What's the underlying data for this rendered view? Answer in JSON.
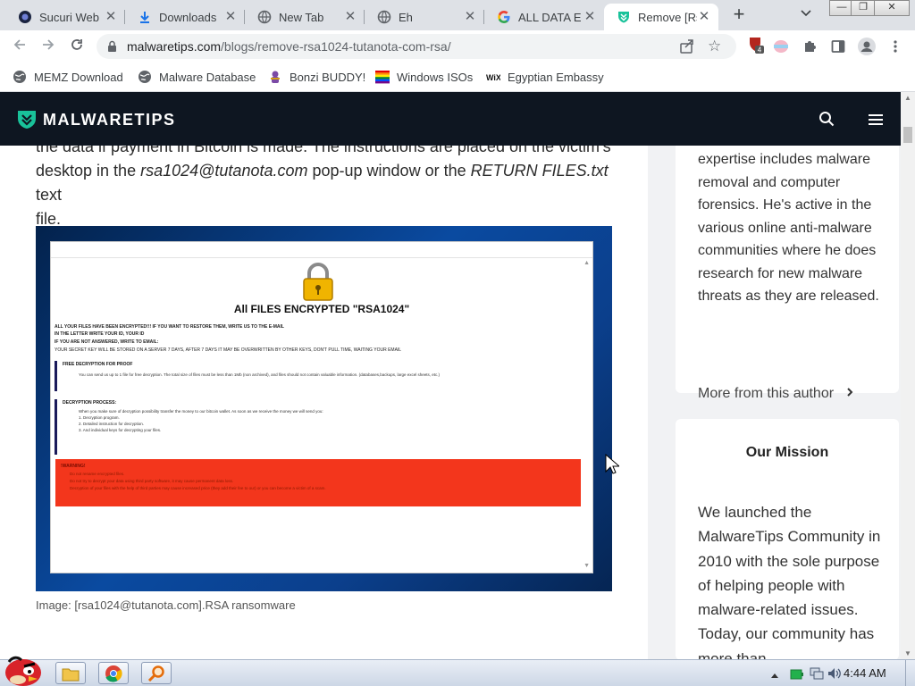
{
  "tabs": [
    {
      "title": "Sucuri Web",
      "icon": "sucuri-icon"
    },
    {
      "title": "Downloads",
      "icon": "download-icon"
    },
    {
      "title": "New Tab",
      "icon": "globe-icon"
    },
    {
      "title": "Eh",
      "icon": "globe-icon"
    },
    {
      "title": "ALL DATA E",
      "icon": "google-icon"
    },
    {
      "title": "Remove [Rs",
      "icon": "malwaretips-icon",
      "active": true
    }
  ],
  "window_controls": {
    "minimize": "—",
    "restore": "❐",
    "close": "✕"
  },
  "address_bar": {
    "host": "malwaretips.com",
    "path": "/blogs/remove-rsa1024-tutanota-com-rsa/"
  },
  "extensions": {
    "badge_count": "4"
  },
  "bookmarks": [
    {
      "label": "MEMZ Download",
      "icon": "globe-icon"
    },
    {
      "label": "Malware Database",
      "icon": "globe-icon"
    },
    {
      "label": "Bonzi BUDDY!",
      "icon": "bonzi-icon"
    },
    {
      "label": "Windows ISOs",
      "icon": "rainbow-flag-icon"
    },
    {
      "label": "Egyptian Embassy",
      "icon": "wix-icon"
    }
  ],
  "site": {
    "logo_text": "MALWARETIPS"
  },
  "article": {
    "line1": "the data if payment in Bitcoin is made. The instructions are placed on the victim’s",
    "line2_a": "desktop in the ",
    "line2_em1": "rsa1024@tutanota.com",
    "line2_b": " pop-up window or the ",
    "line2_em2": "RETURN FILES.txt",
    "line2_c": " text",
    "line3": "file."
  },
  "ransom_note": {
    "title": "All FILES ENCRYPTED \"RSA1024\"",
    "intro": [
      "ALL YOUR FILES HAVE BEEN ENCRYPTED!!! IF YOU WANT TO RESTORE THEM, WRITE US TO THE E-MAIL",
      "IN THE LETTER WRITE YOUR ID, YOUR ID",
      "IF YOU ARE NOT ANSWERED, WRITE TO EMAIL:",
      "YOUR SECRET KEY WILL BE STORED ON A SERVER 7 DAYS, AFTER 7 DAYS IT MAY BE OVERWRITTEN BY OTHER KEYS, DON'T PULL TIME, WAITING YOUR EMAIL"
    ],
    "free_heading": "FREE DECRYPTION FOR PROOF",
    "free_text": "You can send us up to 1 file for free decryption. The total size of files must be less than 1Mb (non archived), and files should not contain valuable information. (databases,backups, large excel sheets, etc.)",
    "process_heading": "DECRYPTION PROCESS:",
    "process_intro": "When you make sure of decryption possibility transfer the money to our bitcoin wallet. As soon as we receive the money we will send you:",
    "process_steps": [
      "1. Decryption program.",
      "2. Detailed instruction for decryption.",
      "3. And individual keys for decrypting your files."
    ],
    "warning_heading": "!WARNING!",
    "warnings": [
      "Do not rename encrypted files.",
      "Do not try to decrypt your data using third party software, it may cause permanent data loss.",
      "Decryption of your files with the help of third parties may cause increased price (they add their fee to our) or you can become a victim of a scam."
    ]
  },
  "caption": "Image: [rsa1024@tutanota.com].RSA ransomware",
  "sidebar": {
    "bio": "expertise includes malware removal and computer forensics. He's active in the various online anti-malware communities where he does research for new malware threats as they are released.",
    "more_link": "More from this author",
    "mission_heading": "Our Mission",
    "mission_text": "We launched the MalwareTips Community in 2010 with the sole purpose of helping people with malware-related issues. Today, our community has more than"
  },
  "taskbar": {
    "clock": "4:44 AM"
  },
  "colors": {
    "site_header": "#0e1621",
    "brand_green": "#19c29a",
    "warning_red": "#f3361c"
  }
}
